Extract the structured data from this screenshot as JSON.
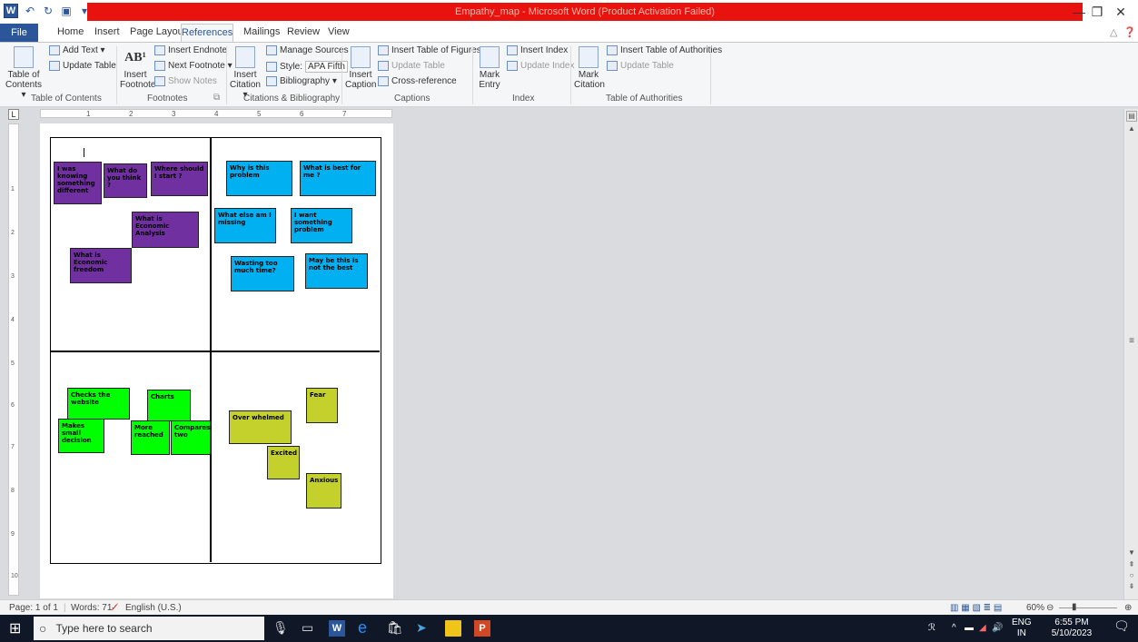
{
  "window": {
    "title": "Empathy_map - Microsoft Word (Product Activation Failed)",
    "app_icon": "W",
    "brand_color": "#2b579a",
    "title_bar_color": "#e8120f"
  },
  "tabs": {
    "file": "File",
    "home": "Home",
    "insert": "Insert",
    "page_layout": "Page Layout",
    "references": "References",
    "mailings": "Mailings",
    "review": "Review",
    "view": "View"
  },
  "ribbon": {
    "toc": {
      "table_of_contents": "Table of",
      "contents": "Contents ▾",
      "add_text": "Add Text ▾",
      "update_table": "Update Table",
      "group": "Table of Contents"
    },
    "footnotes": {
      "insert_footnote_1": "Insert",
      "insert_footnote_2": "Footnote",
      "ab_icon": "AB¹",
      "insert_endnote": "Insert Endnote",
      "next_footnote": "Next Footnote ▾",
      "show_notes": "Show Notes",
      "group": "Footnotes"
    },
    "citations": {
      "insert_citation_1": "Insert",
      "insert_citation_2": "Citation ▾",
      "manage_sources": "Manage Sources",
      "style_label": "Style:",
      "style_value": "APA Fifth",
      "bibliography": "Bibliography ▾",
      "group": "Citations & Bibliography"
    },
    "captions": {
      "insert_caption_1": "Insert",
      "insert_caption_2": "Caption",
      "insert_table_of_figures": "Insert Table of Figures",
      "update_table": "Update Table",
      "cross_reference": "Cross-reference",
      "group": "Captions"
    },
    "index": {
      "mark_entry_1": "Mark",
      "mark_entry_2": "Entry",
      "insert_index": "Insert Index",
      "update_index": "Update Index",
      "group": "Index"
    },
    "authorities": {
      "mark_citation_1": "Mark",
      "mark_citation_2": "Citation",
      "insert_toa": "Insert Table of Authorities",
      "update_table": "Update Table",
      "group": "Table of Authorities"
    }
  },
  "ruler": {
    "h_marks": [
      "1",
      "2",
      "3",
      "4",
      "5",
      "6",
      "7"
    ],
    "v_marks": [
      "1",
      "2",
      "3",
      "4",
      "5",
      "6",
      "7",
      "8",
      "9",
      "10"
    ]
  },
  "notes": {
    "purple": [
      "I was knowing something different",
      "What do you think ?",
      "Where should I start ?",
      "What is Economic Analysis",
      "What is Economic freedom"
    ],
    "blue": [
      "Why is this problem",
      "What is best for me ?",
      "What else am I missing",
      "I want something problem",
      "Wasting too much time?",
      "May be this is not the best"
    ],
    "green": [
      "Checks the website",
      "Charts",
      "Makes small decision",
      "More reached",
      "Compares two"
    ],
    "olive": [
      "Fear",
      "Over whelmed",
      "Excited",
      "Anxious"
    ]
  },
  "note_colors": {
    "purple": "#7030a0",
    "blue": "#00b0f0",
    "green": "#00ff00",
    "olive": "#c4d12c"
  },
  "status": {
    "page": "Page: 1 of 1",
    "words": "Words: 71",
    "language": "English (U.S.)",
    "zoom": "60%"
  },
  "taskbar": {
    "search_placeholder": "Type here to search",
    "lang_1": "ENG",
    "lang_2": "IN",
    "time": "6:55 PM",
    "date": "5/10/2023"
  }
}
